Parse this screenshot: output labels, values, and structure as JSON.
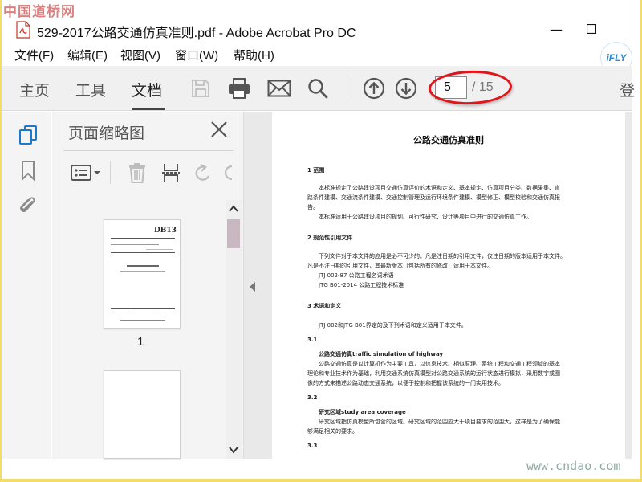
{
  "watermark_top": "中国道桥网",
  "watermark_bottom": "www.cndao.com",
  "window": {
    "title": "529-2017公路交通仿真准则.pdf - Adobe Acrobat Pro DC",
    "minimize_glyph": "—",
    "maximize_glyph": "☐"
  },
  "menu": {
    "items": [
      "文件(F)",
      "编辑(E)",
      "视图(V)",
      "窗口(W)",
      "帮助(H)"
    ]
  },
  "ifly_logo": "iFLY",
  "toolbar": {
    "tabs": [
      "主页",
      "工具",
      "文档"
    ],
    "active_tab": "文档",
    "current_page": "5",
    "total_pages": "/ 15",
    "login": "登"
  },
  "panel": {
    "title": "页面缩略图",
    "thumb1_header": "DB13",
    "thumb1_label": "1"
  },
  "document": {
    "title": "公路交通仿真准则",
    "lines": [
      {
        "text": "1  范围",
        "bold": true
      },
      {
        "text": "本标准规定了公路建设项目交通仿真评价的术语和定义、基本规定、仿真项目分类、数据采集、道"
      },
      {
        "text": "路条件建模、交通流条件建模、交通控制管理及运行环境条件建模、模型修正、模型校验和交通仿真报"
      },
      {
        "text": "告。"
      },
      {
        "text": "本标准适用于公路建设项目的规划、可行性研究、设计等项目中进行的交通仿真工作。"
      },
      {
        "text": "2  规范性引用文件",
        "bold": true
      },
      {
        "text": "下列文件对于本文件的应用是必不可少的。凡是注日期的引用文件，仅注日期的版本适用于本文件。"
      },
      {
        "text": "凡是不注日期的引用文件，其最新版本（包括所有的修改）适用于本文件。"
      },
      {
        "text": "JTJ 002-87  公路工程名词术语"
      },
      {
        "text": "JTG B01-2014  公路工程技术标准"
      },
      {
        "text": "3  术语和定义",
        "bold": true
      },
      {
        "text": "JTJ 002和JTG B01界定的及下列术语和定义适用于本文件。"
      },
      {
        "text": "3.1",
        "bold": true
      },
      {
        "text": "公路交通仿真traffic simulation of highway",
        "bold": true
      },
      {
        "text": "公路交通仿真是以计算机作为主要工具，以信息技术、相似原理、系统工程和交通工程领域的基本"
      },
      {
        "text": "理论和专业技术作为基础，利用交通系统仿真模型对公路交通系统的运行状态进行模拟，采用数字或图"
      },
      {
        "text": "像的方式来描述公路动态交通系统，以便于控制和把握该系统的一门实用技术。"
      },
      {
        "text": "3.2",
        "bold": true
      },
      {
        "text": "研究区域study area coverage",
        "bold": true
      },
      {
        "text": "研究区域指仿真模型所包含的区域。研究区域的范围应大于项目要求的范围大，这样是为了确保能"
      },
      {
        "text": "够满足相关的要求。"
      },
      {
        "text": "3.3",
        "bold": true
      }
    ]
  }
}
